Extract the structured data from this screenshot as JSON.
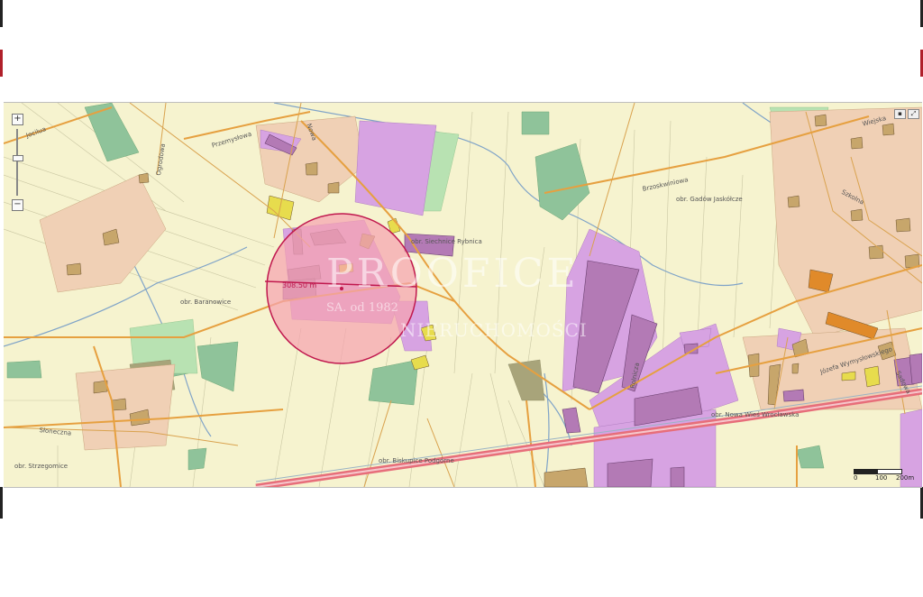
{
  "map": {
    "measurement": "308.50 m",
    "watermark": {
      "logo": "PROOFICE",
      "line1": "SA. od 1982",
      "line2": "NIERUCHOMOŚCI"
    },
    "streets": {
      "przemyslowa": "Przemysłowa",
      "nowa": "Nowa",
      "brzoskwiniowa": "Brzoskwiniowa",
      "wiejska": "Wiejska",
      "sloneczna": "Słoneczna",
      "wymyslowskiego": "Józefa Wymysłowskiego",
      "sadowa": "Sadowa",
      "ogrodowa": "Ogrodowa",
      "rolnicza": "Rolnicza",
      "szkolna": "Szkolna",
      "ulica_left": "Jocilua"
    },
    "districts": {
      "siechnice": "obr. Siechnice Rybnica",
      "baranowice": "obr. Baranowice",
      "strzegomice": "obr. Strzegomice",
      "biskupice": "obr. Biskupice Podgórne",
      "gadow": "obr. Gadów Jaskółcze",
      "nowa_wies": "obr. Nowa Wieś Wrocławska"
    },
    "scale": {
      "tick0": "0",
      "tick1": "100",
      "tick2": "200m"
    },
    "controls": {
      "zoom_in": "+",
      "zoom_out": "−",
      "layers": "▪",
      "fullscreen": "⤢"
    },
    "colors": {
      "agricultural": "#f6f3cf",
      "residential": "#f0d0b5",
      "industrial": "#d7a3e2",
      "commercial_building": "#9a67a7",
      "forest": "#8fc39a",
      "railway": "#e76e7a",
      "circle_fill": "#f5a4b0",
      "circle_stroke": "#c0184e",
      "street": "#e6a040",
      "water": "#7fa3c8"
    }
  }
}
